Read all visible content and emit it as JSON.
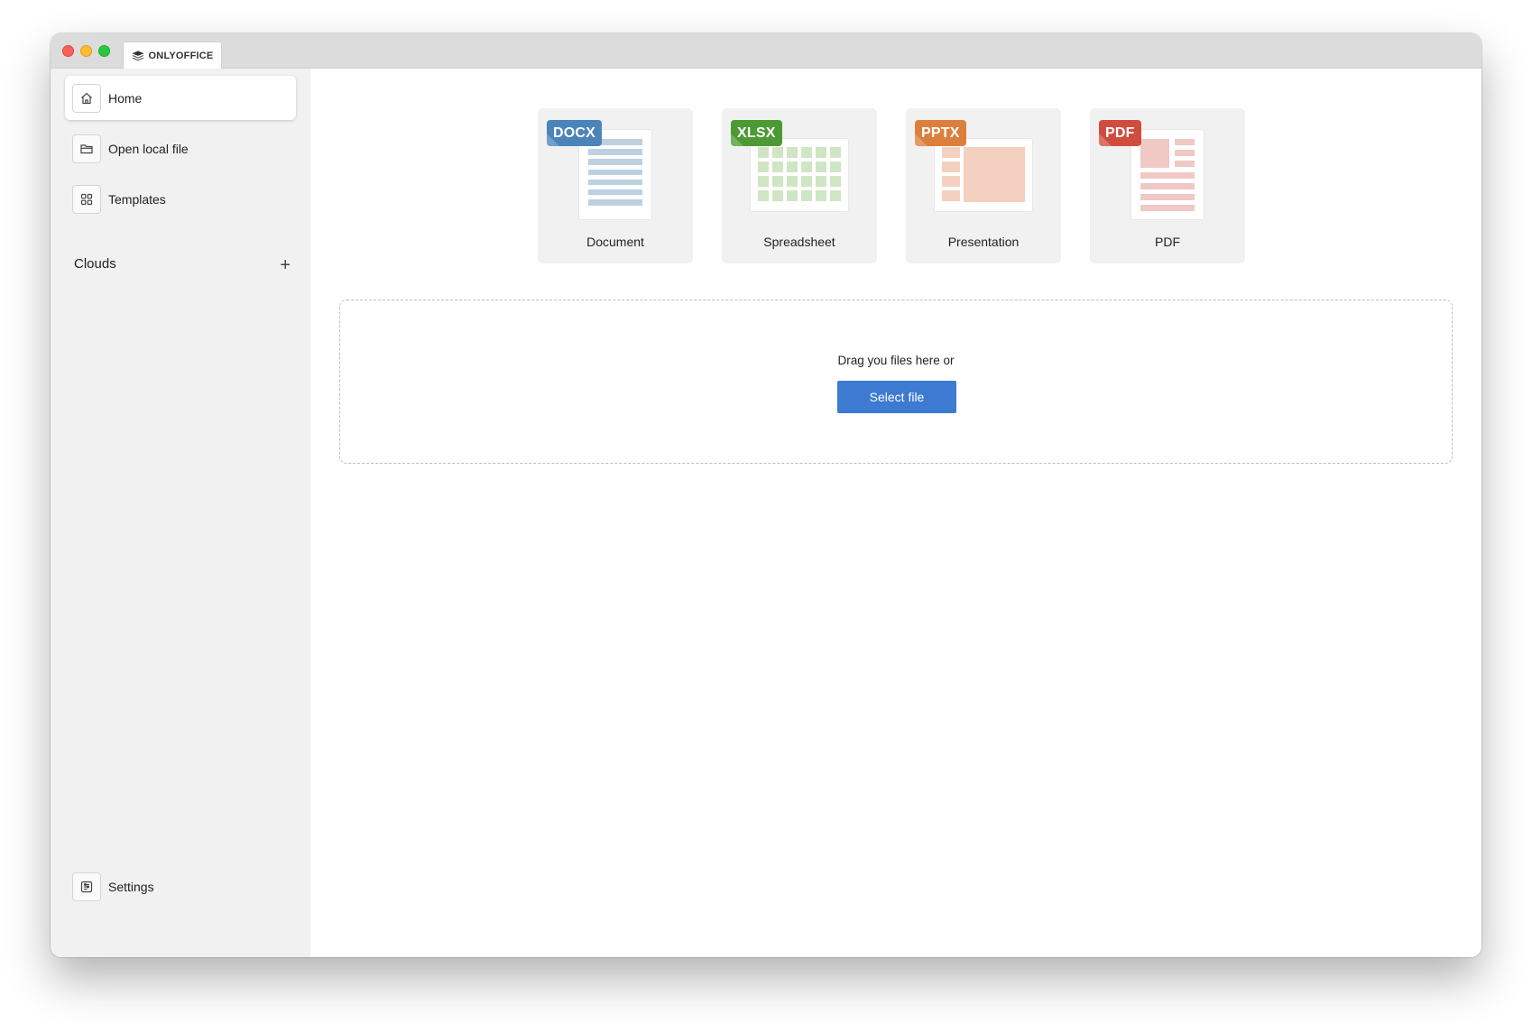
{
  "app": {
    "tab_label": "ONLYOFFICE"
  },
  "sidebar": {
    "items": [
      {
        "label": "Home",
        "icon": "home-icon",
        "active": true
      },
      {
        "label": "Open local file",
        "icon": "folder-icon"
      },
      {
        "label": "Templates",
        "icon": "templates-icon"
      }
    ],
    "clouds_label": "Clouds",
    "clouds_add": "+",
    "settings_label": "Settings"
  },
  "cards": [
    {
      "label": "Document",
      "badge": "DOCX",
      "badge_color": "#4a84b8"
    },
    {
      "label": "Spreadsheet",
      "badge": "XLSX",
      "badge_color": "#4d9a34"
    },
    {
      "label": "Presentation",
      "badge": "PPTX",
      "badge_color": "#dd7f3c"
    },
    {
      "label": "PDF",
      "badge": "PDF",
      "badge_color": "#d04d3e"
    }
  ],
  "dropzone": {
    "text": "Drag you files here or",
    "button_label": "Select file",
    "button_color": "#3d7ad1"
  }
}
